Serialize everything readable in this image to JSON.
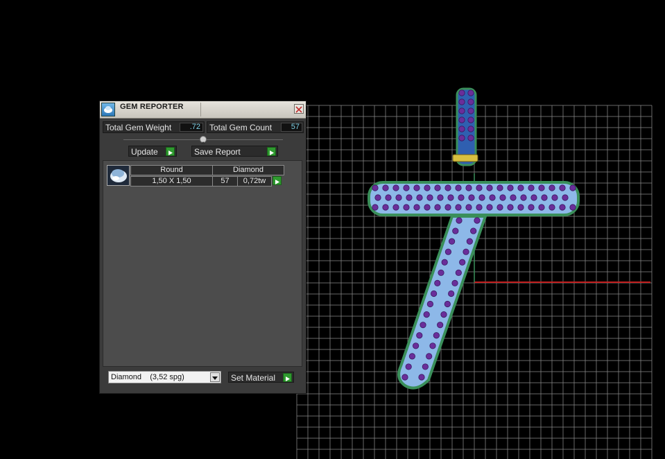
{
  "panel": {
    "title": "GEM REPORTER",
    "total_weight_label": "Total Gem Weight",
    "total_weight_value": ".72",
    "total_count_label": "Total Gem Count",
    "total_count_value": "57",
    "update_label": "Update",
    "save_report_label": "Save Report",
    "gems": [
      {
        "cut": "Round",
        "material": "Diamond",
        "size": "1,50 X 1,50",
        "count": "57",
        "weight": "0,72tw"
      }
    ],
    "material_select_value": "Diamond    (3,52 spg)",
    "set_material_label": "Set Material"
  },
  "colors": {
    "grid_line": "#8a8a8a",
    "gem_fill": "#8db8e8",
    "gem_outline": "#3a8f5a",
    "gem_stone": "#6a2e9a",
    "axis_red": "#c41e1e",
    "play_green": "#2f9a2f"
  },
  "icons": {
    "app": "gem-reporter-icon",
    "close": "close-icon",
    "thumb": "round-gem-icon",
    "play": "play-arrow-icon",
    "collapse": "chevron-up-icon",
    "dropdown": "chevron-down-icon"
  }
}
